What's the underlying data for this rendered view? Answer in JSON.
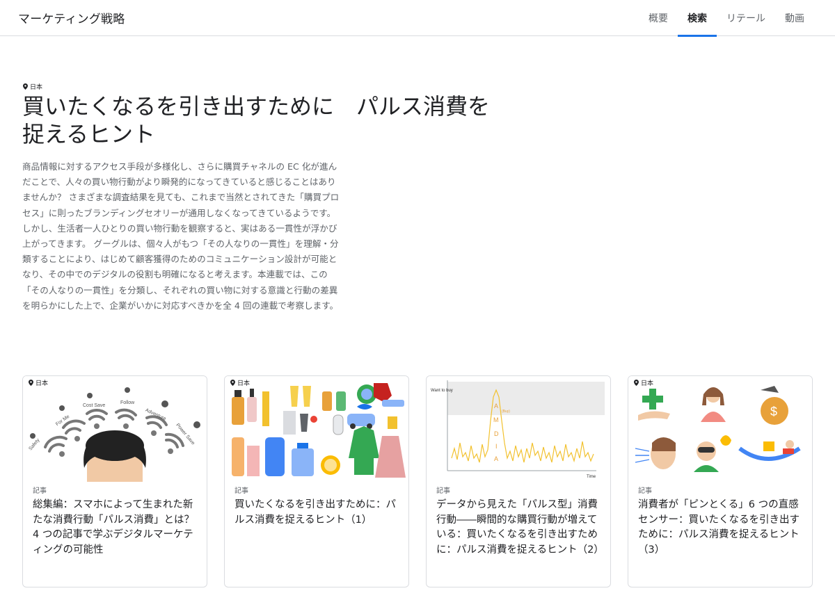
{
  "header": {
    "brand": "マーケティング戦略",
    "nav": [
      {
        "label": "概要",
        "active": false
      },
      {
        "label": "検索",
        "active": true
      },
      {
        "label": "リテール",
        "active": false
      },
      {
        "label": "動画",
        "active": false
      }
    ]
  },
  "hero": {
    "location": "日本",
    "title_line1": "買いたくなるを引き出すために　パルス消費を",
    "title_line2": "捉えるヒント",
    "body": "商品情報に対するアクセス手段が多様化し、さらに購買チャネルの EC 化が進んだことで、人々の買い物行動がより瞬発的になってきていると感じることはありませんか？ さまざまな調査結果を見ても、これまで当然とされてきた「購買プロセス」に則ったブランディングセオリーが通用しなくなってきているようです。しかし、生活者一人ひとりの買い物行動を観察すると、実はある一貫性が浮かび上がってきます。 グーグルは、個々人がもつ「その人なりの一貫性」を理解・分類することにより、はじめて顧客獲得のためのコミュニケーション設計が可能となり、その中でのデジタルの役割も明確になると考えます。本連載では、この「その人なりの一貫性」を分類し、それぞれの買い物に対する意識と行動の差異を明らかにした上で、企業がいかに対応すべきかを全 4 回の連載で考察します。"
  },
  "cards": [
    {
      "location": "日本",
      "category": "記事",
      "title": "総集編：スマホによって生まれた新たな消費行動「パルス消費」とは？ 4 つの記事で学ぶデジタルマーケティングの可能性",
      "image_labels": [
        "Safety",
        "For Me",
        "Cost Save",
        "Follow",
        "Adventure",
        "Power Save"
      ]
    },
    {
      "location": "日本",
      "category": "記事",
      "title": "買いたくなるを引き出すために：パルス消費を捉えるヒント（1）"
    },
    {
      "location": "日本",
      "category": "記事",
      "title": "データから見えた「パルス型」消費行動――瞬間的な購買行動が増えている：買いたくなるを引き出すために：パルス消費を捉えるヒント（2）",
      "chart": {
        "ylabel": "Want to buy",
        "xlabel": "Time",
        "letters": [
          "A",
          "M",
          "D",
          "I",
          "A"
        ],
        "peak_label": "(Buy)"
      }
    },
    {
      "location": "日本",
      "category": "記事",
      "title": "消費者が「ピンとくる」6 つの直感センサー：買いたくなるを引き出すために：パルス消費を捉えるヒント（3）"
    }
  ],
  "colors": {
    "accent": "#1a73e8",
    "chart_line": "#f2c12e",
    "green": "#34a853",
    "yellow": "#fbbc04",
    "red": "#ea4335"
  }
}
